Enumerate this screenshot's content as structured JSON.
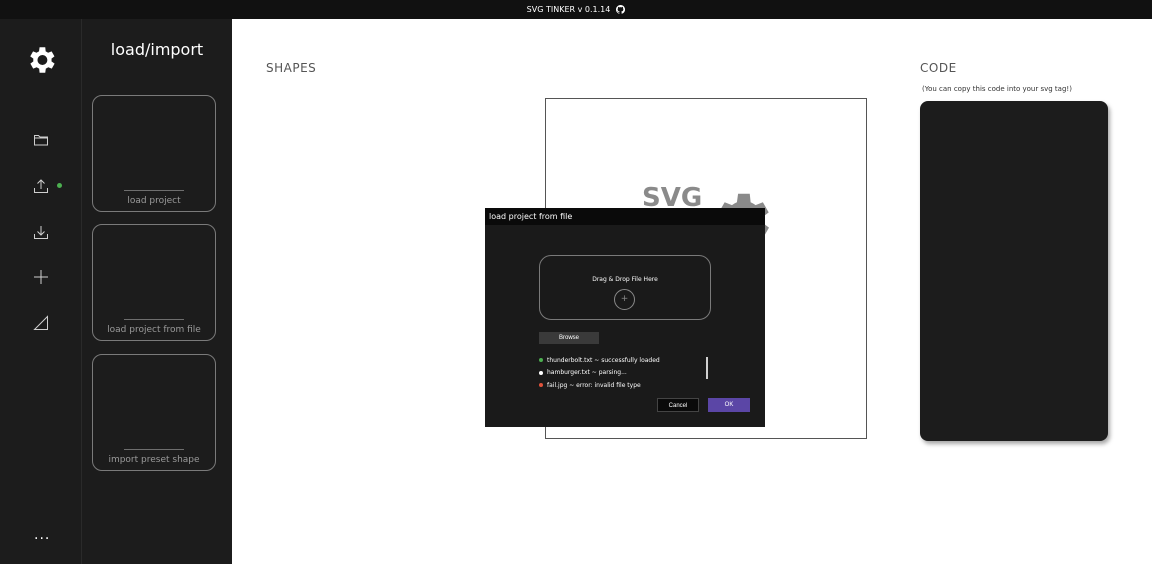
{
  "app": {
    "title": "SVG TINKER v 0.1.14"
  },
  "colors": {
    "accent": "#5b46a6",
    "success": "#4caf50",
    "warning": "#ffffff",
    "error": "#e0533b",
    "dark": "#1c1c1c"
  },
  "rail": {
    "icons": [
      "gear-icon",
      "folder-icon",
      "upload-icon",
      "download-icon",
      "plus-icon",
      "shape-icon"
    ],
    "more_label": "..."
  },
  "panel": {
    "title": "load/import",
    "cards": [
      {
        "label": "load project"
      },
      {
        "label": "load project from file"
      },
      {
        "label": "import preset shape"
      }
    ]
  },
  "shapes": {
    "heading": "SHAPES",
    "watermark": "SVG"
  },
  "code": {
    "heading": "CODE",
    "subtitle": "(You can copy this code into your svg tag!)"
  },
  "modal": {
    "title": "load project from file",
    "drop_text": "Drag & Drop File Here",
    "drop_plus": "+",
    "browse_label": "Browse",
    "files": [
      {
        "text": "thunderbolt.txt ~ successfully loaded",
        "status": "success"
      },
      {
        "text": "hamburger.txt ~ parsing...",
        "status": "parsing"
      },
      {
        "text": "fail.jpg ~ error: invalid file type",
        "status": "error"
      }
    ],
    "cancel_label": "Cancel",
    "ok_label": "OK"
  }
}
